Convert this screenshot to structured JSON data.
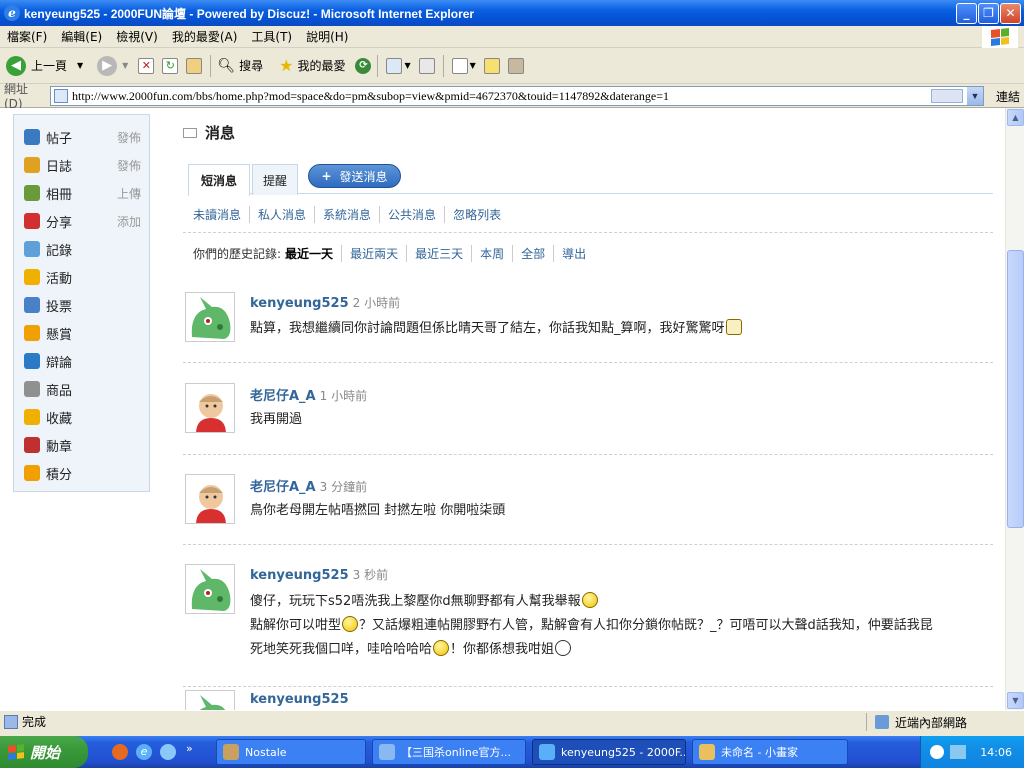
{
  "window": {
    "title": "kenyeung525 - 2000FUN論壇 - Powered by Discuz! - Microsoft Internet Explorer"
  },
  "menu": {
    "items": [
      "檔案(F)",
      "編輯(E)",
      "檢視(V)",
      "我的最愛(A)",
      "工具(T)",
      "說明(H)"
    ]
  },
  "toolbar": {
    "back_label": "上一頁",
    "search_label": "搜尋",
    "favorites_label": "我的最愛"
  },
  "address": {
    "label": "網址(D)",
    "url": "http://www.2000fun.com/bbs/home.php?mod=space&do=pm&subop=view&pmid=4672370&touid=1147892&daterange=1",
    "go_label": "連結"
  },
  "sidebar": {
    "items": [
      {
        "label": "帖子",
        "action": "發佈",
        "icon": "post-icon",
        "color": "#3a7ac0"
      },
      {
        "label": "日誌",
        "action": "發佈",
        "icon": "blog-icon",
        "color": "#e0a020"
      },
      {
        "label": "相冊",
        "action": "上傳",
        "icon": "album-icon",
        "color": "#6a9a3a"
      },
      {
        "label": "分享",
        "action": "添加",
        "icon": "share-icon",
        "color": "#d03030"
      },
      {
        "label": "記錄",
        "action": "",
        "icon": "record-icon",
        "color": "#60a0d8"
      },
      {
        "label": "活動",
        "action": "",
        "icon": "activity-icon",
        "color": "#f0b000"
      },
      {
        "label": "投票",
        "action": "",
        "icon": "poll-icon",
        "color": "#4a80c8"
      },
      {
        "label": "懸賞",
        "action": "",
        "icon": "reward-icon",
        "color": "#f0a000"
      },
      {
        "label": "辯論",
        "action": "",
        "icon": "debate-icon",
        "color": "#2a7ac8"
      },
      {
        "label": "商品",
        "action": "",
        "icon": "goods-icon",
        "color": "#909090"
      },
      {
        "label": "收藏",
        "action": "",
        "icon": "favorite-icon",
        "color": "#f0b000"
      },
      {
        "label": "勳章",
        "action": "",
        "icon": "medal-icon",
        "color": "#c03030"
      },
      {
        "label": "積分",
        "action": "",
        "icon": "credits-icon",
        "color": "#f0a000"
      }
    ]
  },
  "main": {
    "title": "消息",
    "tabs": [
      {
        "label": "短消息"
      },
      {
        "label": "提醒"
      }
    ],
    "send_button": "發送消息",
    "filters": [
      "未讀消息",
      "私人消息",
      "系統消息",
      "公共消息",
      "忽略列表"
    ],
    "history": {
      "label": "你們的歷史記錄:",
      "options": [
        "最近一天",
        "最近兩天",
        "最近三天",
        "本周",
        "全部",
        "導出"
      ]
    },
    "messages": [
      {
        "author": "kenyeung525",
        "time": "2 小時前",
        "lines": [
          "點算，我想繼續同你討論問題但係比晴天哥了結左，你話我知點_算啊，我好驚驚呀"
        ]
      },
      {
        "author": "老尼仔A_A",
        "time": "1 小時前",
        "lines": [
          "我再開過"
        ]
      },
      {
        "author": "老尼仔A_A",
        "time": "3 分鐘前",
        "lines": [
          "鳥你老母開左帖唔撚回 封撚左啦 你開啦柒頭"
        ]
      },
      {
        "author": "kenyeung525",
        "time": "3 秒前",
        "lines": [
          "傻仔，玩玩下s52唔洗我上黎壓你d無聊野都有人幫我舉報",
          "點解你可以咁型",
          "？又話爆粗連帖開膠野冇人管，點解會有人扣你分鎖你帖既？_？可唔可以大聲d話我知，仲要話我昆",
          "死地笑死我個口咩，哇哈哈哈哈",
          "！你都係想我咁姐"
        ]
      },
      {
        "author": "kenyeung525",
        "time": "",
        "lines": []
      }
    ]
  },
  "status": {
    "text": "完成",
    "zone": "近端內部網路"
  },
  "taskbar": {
    "start": "開始",
    "items": [
      "Nostale",
      "【三国杀online官方...",
      "kenyeung525 - 2000F...",
      "未命名 - 小畫家"
    ],
    "clock": "14:06"
  }
}
